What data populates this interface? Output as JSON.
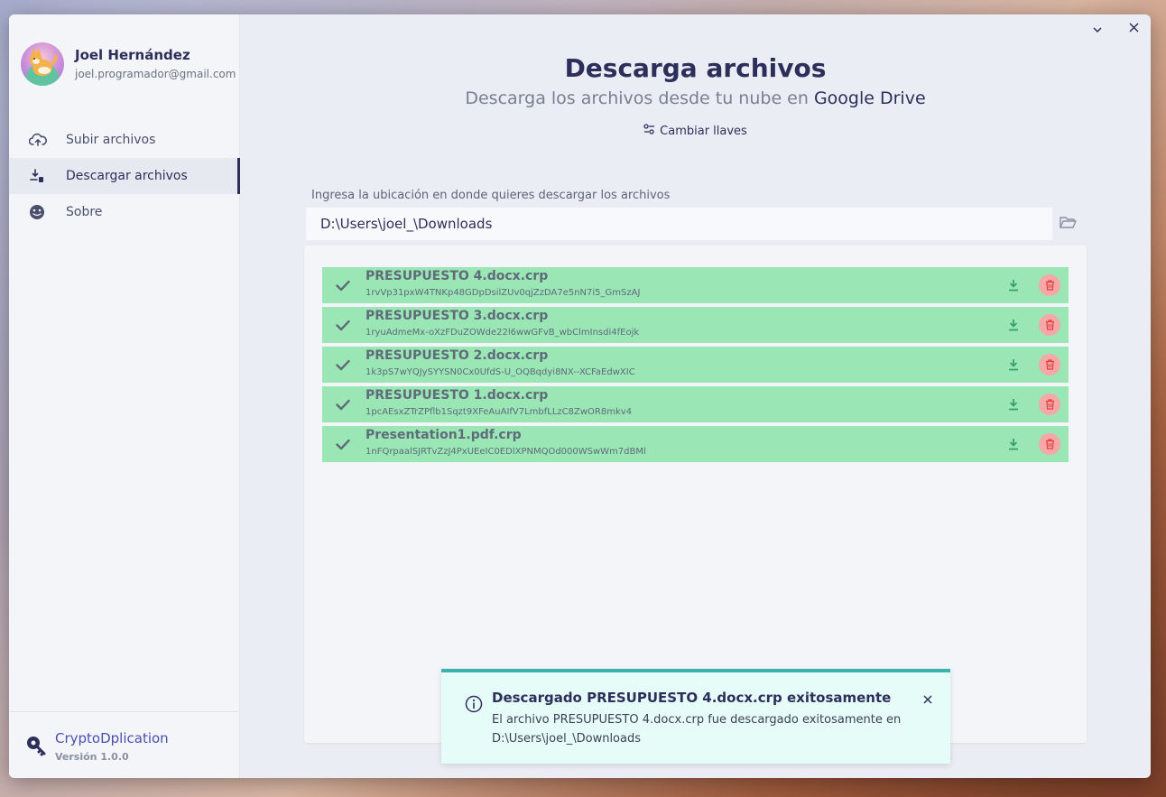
{
  "user": {
    "name": "Joel Hernández",
    "email": "joel.programador@gmail.com"
  },
  "nav": {
    "items": [
      {
        "label": "Subir archivos",
        "icon": "cloud-upload-icon",
        "active": false
      },
      {
        "label": "Descargar archivos",
        "icon": "download-file-icon",
        "active": true
      },
      {
        "label": "Sobre",
        "icon": "info-face-icon",
        "active": false
      }
    ]
  },
  "brand": {
    "name_part1": "Crypto",
    "name_part2": "Dplication",
    "version": "Versión 1.0.0"
  },
  "header": {
    "title": "Descarga archivos",
    "subtitle_prefix": "Descarga los archivos desde tu nube en ",
    "subtitle_highlight": "Google Drive",
    "change_keys_label": "Cambiar llaves"
  },
  "download": {
    "path_label": "Ingresa la ubicación en donde quieres descargar los archivos",
    "path_value": "D:\\Users\\joel_\\Downloads"
  },
  "files": [
    {
      "name": "PRESUPUESTO 4.docx.crp",
      "id": "1rvVp31pxW4TNKp48GDpDsilZUv0qjZzDA7e5nN7i5_GmSzAJ"
    },
    {
      "name": "PRESUPUESTO 3.docx.crp",
      "id": "1ryuAdmeMx-oXzFDuZOWde22l6wwGFvB_wbClmInsdi4fEojk"
    },
    {
      "name": "PRESUPUESTO 2.docx.crp",
      "id": "1k3pS7wYQJySYYSN0Cx0UfdS-U_OQBqdyi8NX--XCFaEdwXIC"
    },
    {
      "name": "PRESUPUESTO 1.docx.crp",
      "id": "1pcAEsxZTrZPflb1Sqzt9XFeAuAIfV7LmbfLLzC8ZwOR8mkv4"
    },
    {
      "name": "Presentation1.pdf.crp",
      "id": "1nFQrpaalSJRTvZzJ4PxUEeIC0EDlXPNMQOd000WSwWm7dBMl"
    }
  ],
  "toast": {
    "title": "Descargado PRESUPUESTO 4.docx.crp exitosamente",
    "description": "El archivo PRESUPUESTO 4.docx.crp fue descargado exitosamente en D:\\Users\\joel_\\Downloads"
  },
  "colors": {
    "primary": "#2d2f5a",
    "accent": "#4b4fb0",
    "success_row": "#9ae6b5",
    "delete_bg": "#f6a7a7",
    "toast_border": "#38b2ac",
    "toast_bg": "#e6fcf8"
  }
}
